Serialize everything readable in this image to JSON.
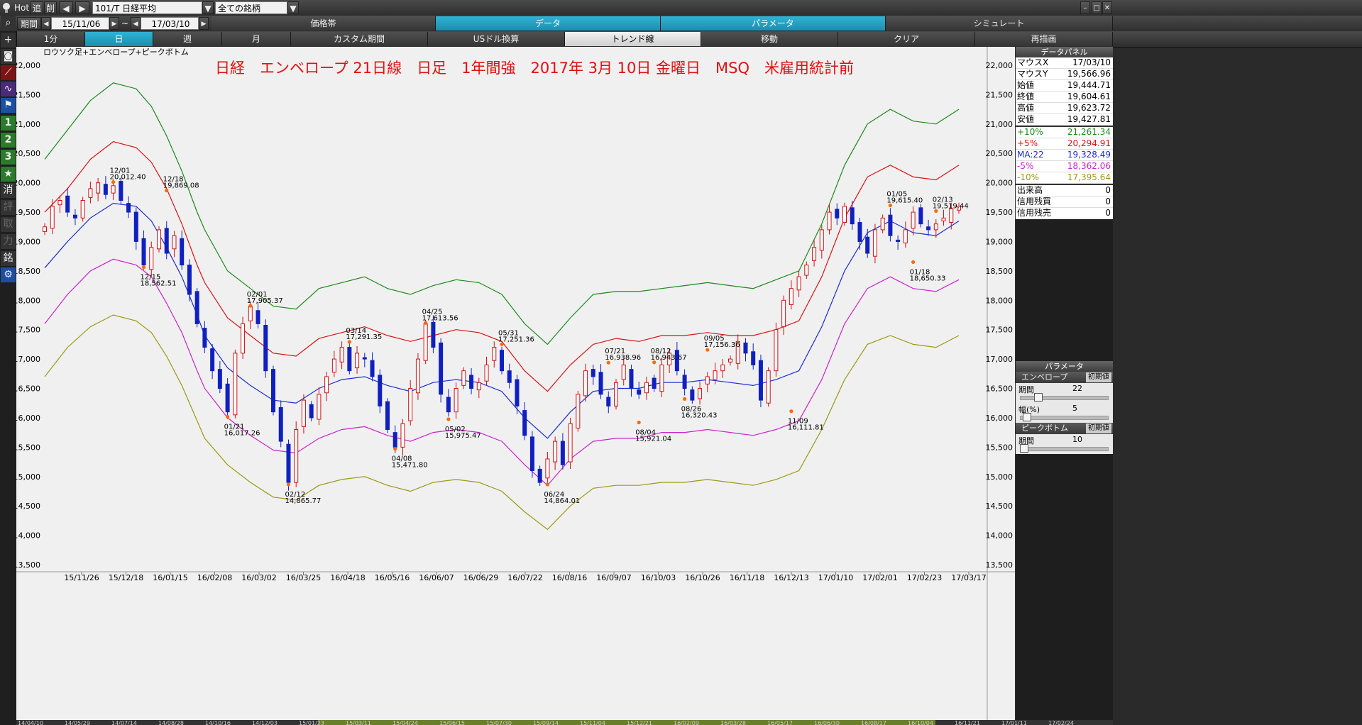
{
  "toolbar": {
    "hot": "Hot",
    "add": "追",
    "del": "削",
    "symbol": "101/T 日経平均",
    "filter": "全ての銘柄"
  },
  "period": {
    "label": "期間",
    "from": "15/11/06",
    "sep": "~",
    "to": "17/03/10",
    "tabs": [
      "価格帯",
      "データ",
      "パラメータ",
      "シミュレート"
    ]
  },
  "range": {
    "tabs": [
      "1分",
      "日",
      "週",
      "月",
      "カスタム期間",
      "USドル換算",
      "トレンド線",
      "移動",
      "クリア"
    ],
    "redraw": "再描画"
  },
  "side_tools": [
    "消",
    "評",
    "取",
    "力",
    "銘"
  ],
  "chart_data": {
    "type": "line",
    "indicator_caption": "ロウソク足+エンベロープ+ピークボトム",
    "title": "日経　エンベロープ 21日線　日足　1年間強　2017年 3月 10日 金曜日　MSQ　米雇用統計前",
    "ylim": [
      13500,
      22500
    ],
    "yticks": [
      "22,000",
      "21,500",
      "21,000",
      "20,500",
      "20,000",
      "19,500",
      "19,000",
      "18,500",
      "18,000",
      "17,500",
      "17,000",
      "16,500",
      "16,000",
      "15,500",
      "15,000",
      "14,500",
      "14,000",
      "13,500"
    ],
    "xlabels": [
      "15/11/26",
      "15/12/18",
      "16/01/15",
      "16/02/08",
      "16/03/02",
      "16/03/25",
      "16/04/18",
      "16/05/16",
      "16/06/07",
      "16/06/29",
      "16/07/22",
      "16/08/16",
      "16/09/07",
      "16/10/03",
      "16/10/26",
      "16/11/18",
      "16/12/13",
      "17/01/10",
      "17/02/01",
      "17/02/23",
      "17/03/17"
    ],
    "overview_labels": [
      "14/04/10",
      "14/05/29",
      "14/07/14",
      "14/08/28",
      "14/10/16",
      "14/12/03",
      "15/01/23",
      "15/03/11",
      "15/04/24",
      "15/06/15",
      "15/07/30",
      "15/09/14",
      "15/11/04",
      "15/12/21",
      "16/02/09",
      "16/03/28",
      "16/05/17",
      "16/06/30",
      "16/08/17",
      "16/10/04",
      "16/11/21",
      "17/01/11",
      "17/02/24"
    ],
    "series": [
      {
        "name": "+10%",
        "color": "#1a8a1a",
        "x": [
          0,
          3,
          6,
          9,
          12,
          14,
          16,
          18,
          20,
          21,
          24,
          27,
          30,
          33,
          36,
          39,
          42,
          45,
          48,
          51,
          54,
          57,
          60,
          63,
          66,
          69,
          72,
          75,
          78,
          81,
          84,
          87,
          90,
          93,
          96,
          99,
          102,
          105,
          108,
          111,
          114,
          117,
          120
        ],
        "values": [
          20400,
          20900,
          21400,
          21700,
          21600,
          21300,
          20800,
          20200,
          19500,
          19200,
          18500,
          18200,
          17900,
          17850,
          18200,
          18300,
          18400,
          18200,
          18100,
          18250,
          18350,
          18300,
          18100,
          17600,
          17250,
          17700,
          18100,
          18150,
          18150,
          18200,
          18250,
          18300,
          18250,
          18200,
          18350,
          18500,
          19300,
          20300,
          21000,
          21250,
          21050,
          21000,
          21250
        ]
      },
      {
        "name": "+5%",
        "color": "#dd1111",
        "x": [
          0,
          3,
          6,
          9,
          12,
          14,
          16,
          18,
          20,
          21,
          24,
          27,
          30,
          33,
          36,
          39,
          42,
          45,
          48,
          51,
          54,
          57,
          60,
          63,
          66,
          69,
          72,
          75,
          78,
          81,
          84,
          87,
          90,
          93,
          96,
          99,
          102,
          105,
          108,
          111,
          114,
          117,
          120
        ],
        "values": [
          19500,
          19900,
          20400,
          20700,
          20600,
          20350,
          19900,
          19300,
          18600,
          18300,
          17700,
          17400,
          17100,
          17050,
          17350,
          17450,
          17550,
          17400,
          17300,
          17400,
          17500,
          17450,
          17300,
          16800,
          16450,
          16900,
          17250,
          17350,
          17300,
          17400,
          17400,
          17450,
          17400,
          17400,
          17500,
          17650,
          18400,
          19400,
          20100,
          20300,
          20100,
          20050,
          20300
        ]
      },
      {
        "name": "MA:22",
        "color": "#1a2ad8",
        "x": [
          0,
          3,
          6,
          9,
          12,
          14,
          16,
          18,
          20,
          21,
          24,
          27,
          30,
          33,
          36,
          39,
          42,
          45,
          48,
          51,
          54,
          57,
          60,
          63,
          66,
          69,
          72,
          75,
          78,
          81,
          84,
          87,
          90,
          93,
          96,
          99,
          102,
          105,
          108,
          111,
          114,
          117,
          120
        ],
        "values": [
          18550,
          19000,
          19400,
          19650,
          19600,
          19350,
          18900,
          18400,
          17750,
          17400,
          16850,
          16550,
          16300,
          16250,
          16500,
          16650,
          16700,
          16550,
          16450,
          16600,
          16650,
          16600,
          16450,
          16000,
          15650,
          16100,
          16450,
          16500,
          16500,
          16600,
          16600,
          16650,
          16600,
          16550,
          16650,
          16800,
          17550,
          18500,
          19150,
          19350,
          19150,
          19100,
          19350
        ]
      },
      {
        "name": "-5%",
        "color": "#cc22cc",
        "x": [
          0,
          3,
          6,
          9,
          12,
          14,
          16,
          18,
          20,
          21,
          24,
          27,
          30,
          33,
          36,
          39,
          42,
          45,
          48,
          51,
          54,
          57,
          60,
          63,
          66,
          69,
          72,
          75,
          78,
          81,
          84,
          87,
          90,
          93,
          96,
          99,
          102,
          105,
          108,
          111,
          114,
          117,
          120
        ],
        "values": [
          17600,
          18100,
          18500,
          18700,
          18600,
          18400,
          17950,
          17450,
          16800,
          16500,
          16000,
          15700,
          15450,
          15400,
          15650,
          15800,
          15850,
          15700,
          15600,
          15750,
          15800,
          15750,
          15600,
          15200,
          14850,
          15300,
          15600,
          15650,
          15650,
          15750,
          15750,
          15800,
          15750,
          15700,
          15800,
          15950,
          16650,
          17600,
          18200,
          18400,
          18200,
          18150,
          18350
        ]
      },
      {
        "name": "-10%",
        "color": "#9a9a10",
        "x": [
          0,
          3,
          6,
          9,
          12,
          14,
          16,
          18,
          20,
          21,
          24,
          27,
          30,
          33,
          36,
          39,
          42,
          45,
          48,
          51,
          54,
          57,
          60,
          63,
          66,
          69,
          72,
          75,
          78,
          81,
          84,
          87,
          90,
          93,
          96,
          99,
          102,
          105,
          108,
          111,
          114,
          117,
          120
        ],
        "values": [
          16700,
          17200,
          17550,
          17750,
          17650,
          17450,
          17050,
          16550,
          15950,
          15650,
          15200,
          14900,
          14650,
          14600,
          14850,
          14950,
          15000,
          14850,
          14750,
          14900,
          14950,
          14900,
          14750,
          14400,
          14100,
          14500,
          14800,
          14850,
          14850,
          14900,
          14900,
          14950,
          14900,
          14850,
          14950,
          15100,
          15800,
          16650,
          17250,
          17400,
          17250,
          17200,
          17400
        ]
      }
    ],
    "candles": [
      19250,
      19600,
      19700,
      19500,
      19400,
      19700,
      19900,
      20000,
      19800,
      19950,
      19700,
      19500,
      19000,
      18600,
      18900,
      19200,
      18800,
      19100,
      18600,
      18100,
      17600,
      17200,
      16800,
      16500,
      16100,
      17100,
      17600,
      17900,
      17600,
      16800,
      16100,
      15600,
      14900,
      15800,
      16300,
      16000,
      16400,
      16700,
      17000,
      17200,
      16800,
      17100,
      17000,
      16700,
      16200,
      15800,
      15500,
      15900,
      16500,
      17000,
      17600,
      17200,
      16400,
      16100,
      16500,
      16800,
      16500,
      16600,
      16900,
      17200,
      16800,
      16600,
      16200,
      15700,
      15100,
      14900,
      15300,
      15600,
      15200,
      15900,
      16400,
      16800,
      16700,
      16400,
      16200,
      16600,
      16900,
      16500,
      16400,
      16600,
      16500,
      16900,
      17100,
      16800,
      16500,
      16300,
      16500,
      16700,
      16800,
      16900,
      17000,
      17300,
      17100,
      16900,
      16300,
      16800,
      17500,
      18000,
      18200,
      18400,
      18600,
      18900,
      19200,
      19500,
      19400,
      19600,
      19300,
      19000,
      18800,
      19200,
      19400,
      19100,
      19000,
      19200,
      19500,
      19300,
      19200,
      19300,
      19400,
      19560,
      19600
    ],
    "peaks": [
      {
        "i": 9,
        "date": "12/01",
        "price": "20,012.40",
        "pos": "above"
      },
      {
        "i": 16,
        "date": "12/18",
        "price": "19,869.08",
        "pos": "above"
      },
      {
        "i": 13,
        "date": "12/15",
        "price": "18,562.51",
        "pos": "below"
      },
      {
        "i": 24,
        "date": "01/21",
        "price": "16,017.26",
        "pos": "below"
      },
      {
        "i": 27,
        "date": "02/01",
        "price": "17,905.37",
        "pos": "above"
      },
      {
        "i": 32,
        "date": "02/12",
        "price": "14,865.77",
        "pos": "below"
      },
      {
        "i": 40,
        "date": "03/14",
        "price": "17,291.35",
        "pos": "above"
      },
      {
        "i": 46,
        "date": "04/08",
        "price": "15,471.80",
        "pos": "below"
      },
      {
        "i": 50,
        "date": "04/25",
        "price": "17,613.56",
        "pos": "above"
      },
      {
        "i": 53,
        "date": "05/02",
        "price": "15,975.47",
        "pos": "below"
      },
      {
        "i": 60,
        "date": "05/31",
        "price": "17,251.36",
        "pos": "above"
      },
      {
        "i": 66,
        "date": "06/24",
        "price": "14,864.01",
        "pos": "below"
      },
      {
        "i": 74,
        "date": "07/21",
        "price": "16,938.96",
        "pos": "above"
      },
      {
        "i": 78,
        "date": "08/04",
        "price": "15,921.04",
        "pos": "below"
      },
      {
        "i": 80,
        "date": "08/12",
        "price": "16,943.67",
        "pos": "above"
      },
      {
        "i": 84,
        "date": "08/26",
        "price": "16,320.43",
        "pos": "below"
      },
      {
        "i": 87,
        "date": "09/05",
        "price": "17,156.36",
        "pos": "above"
      },
      {
        "i": 98,
        "date": "11/09",
        "price": "16,111.81",
        "pos": "below"
      },
      {
        "i": 111,
        "date": "01/05",
        "price": "19,615.40",
        "pos": "above"
      },
      {
        "i": 114,
        "date": "01/18",
        "price": "18,650.33",
        "pos": "below"
      },
      {
        "i": 117,
        "date": "02/13",
        "price": "19,519.44",
        "pos": "above"
      }
    ]
  },
  "panel": {
    "title": "データパネル",
    "rows": [
      {
        "k": "マウスX",
        "v": "17/03/10",
        "color": "#000"
      },
      {
        "k": "マウスY",
        "v": "19,566.96",
        "color": "#000"
      },
      {
        "k": "始値",
        "v": "19,444.71",
        "color": "#000"
      },
      {
        "k": "終値",
        "v": "19,604.61",
        "color": "#000"
      },
      {
        "k": "高値",
        "v": "19,623.72",
        "color": "#000"
      },
      {
        "k": "安値",
        "v": "19,427.81",
        "color": "#000"
      },
      {
        "k": "+10%",
        "v": "21,261.34",
        "color": "#1a8a1a"
      },
      {
        "k": "+5%",
        "v": "20,294.91",
        "color": "#dd1111"
      },
      {
        "k": "MA:22",
        "v": "19,328.49",
        "color": "#1a2ad8"
      },
      {
        "k": "-5%",
        "v": "18,362.06",
        "color": "#cc22cc"
      },
      {
        "k": "-10%",
        "v": "17,395.64",
        "color": "#9a9a10"
      },
      {
        "k": "出来高",
        "v": "0",
        "color": "#000"
      },
      {
        "k": "信用残買",
        "v": "0",
        "color": "#000"
      },
      {
        "k": "信用残売",
        "v": "0",
        "color": "#000"
      }
    ],
    "param_title": "パラメータ",
    "envelope": {
      "name": "エンベロープ",
      "init": "初期値",
      "period_label": "期間",
      "period_value": "22",
      "width_label": "幅(%)",
      "width_value": "5"
    },
    "peak": {
      "name": "ピークボトム",
      "init": "初期値",
      "period_label": "期間",
      "period_value": "10"
    }
  }
}
